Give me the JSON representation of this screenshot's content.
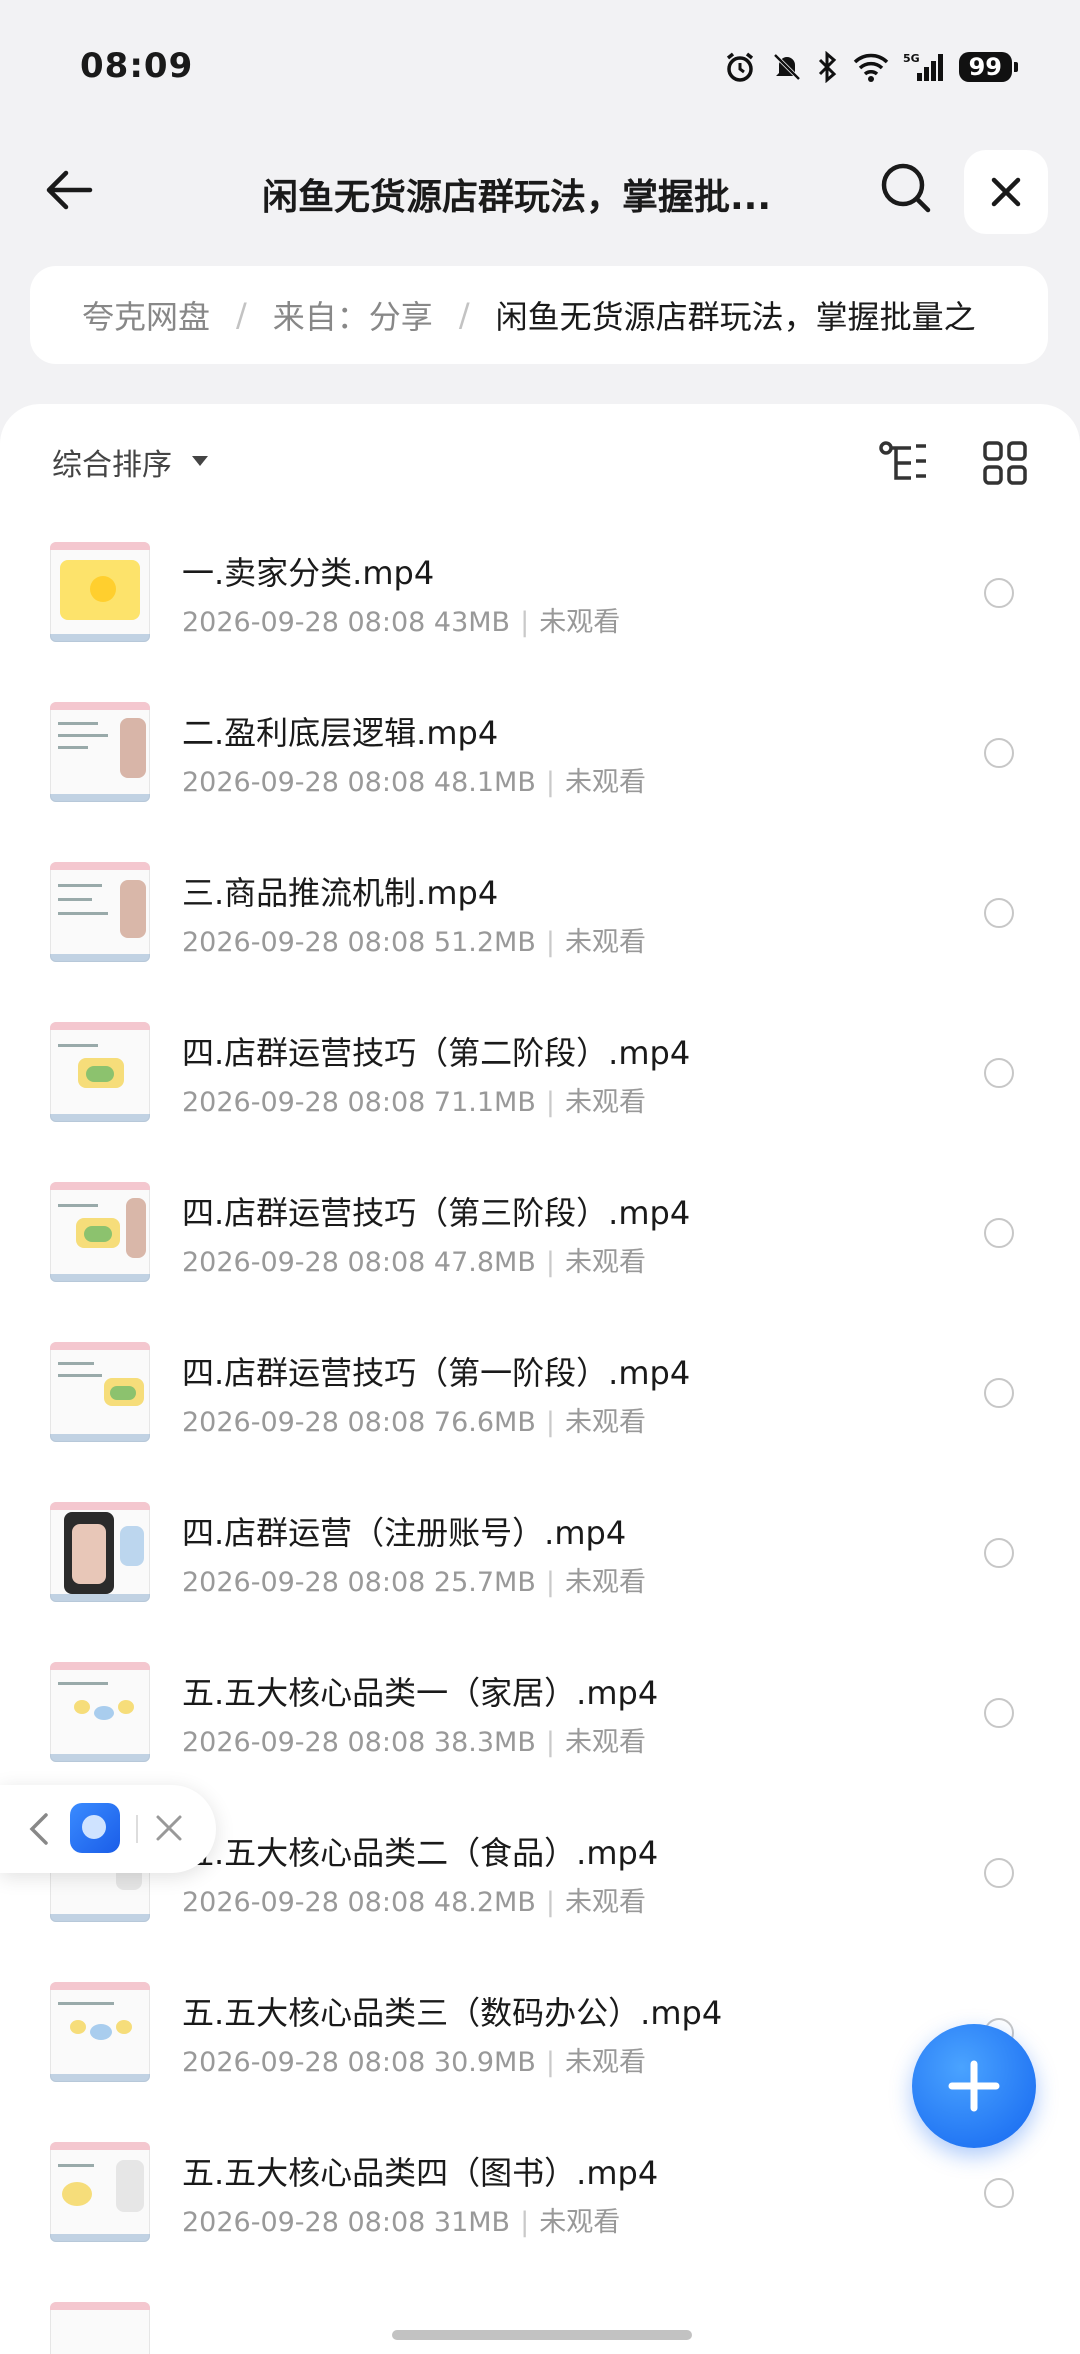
{
  "status": {
    "time": "08:09",
    "battery": "99",
    "signal": "5G"
  },
  "header": {
    "title": "闲鱼无货源店群玩法，掌握批..."
  },
  "breadcrumb": {
    "root": "夸克网盘",
    "from": "来自：分享",
    "current": "闲鱼无货源店群玩法，掌握批量之"
  },
  "toolbar": {
    "sort_label": "综合排序"
  },
  "files": [
    {
      "name": "一.卖家分类.mp4",
      "date": "2026-09-28 08:08",
      "size": "43MB",
      "status": "未观看"
    },
    {
      "name": "二.盈利底层逻辑.mp4",
      "date": "2026-09-28 08:08",
      "size": "48.1MB",
      "status": "未观看"
    },
    {
      "name": "三.商品推流机制.mp4",
      "date": "2026-09-28 08:08",
      "size": "51.2MB",
      "status": "未观看"
    },
    {
      "name": "四.店群运营技巧（第二阶段）.mp4",
      "date": "2026-09-28 08:08",
      "size": "71.1MB",
      "status": "未观看"
    },
    {
      "name": "四.店群运营技巧（第三阶段）.mp4",
      "date": "2026-09-28 08:08",
      "size": "47.8MB",
      "status": "未观看"
    },
    {
      "name": "四.店群运营技巧（第一阶段）.mp4",
      "date": "2026-09-28 08:08",
      "size": "76.6MB",
      "status": "未观看"
    },
    {
      "name": "四.店群运营（注册账号）.mp4",
      "date": "2026-09-28 08:08",
      "size": "25.7MB",
      "status": "未观看"
    },
    {
      "name": "五.五大核心品类一（家居）.mp4",
      "date": "2026-09-28 08:08",
      "size": "38.3MB",
      "status": "未观看"
    },
    {
      "name": "五.五大核心品类二（食品）.mp4",
      "date": "2026-09-28 08:08",
      "size": "48.2MB",
      "status": "未观看"
    },
    {
      "name": "五.五大核心品类三（数码办公）.mp4",
      "date": "2026-09-28 08:08",
      "size": "30.9MB",
      "status": "未观看"
    },
    {
      "name": "五.五大核心品类四（图书）.mp4",
      "date": "2026-09-28 08:08",
      "size": "31MB",
      "status": "未观看"
    }
  ],
  "colors": {
    "accent": "#1466f0",
    "background": "#f2f2f4",
    "meta": "#999999"
  }
}
